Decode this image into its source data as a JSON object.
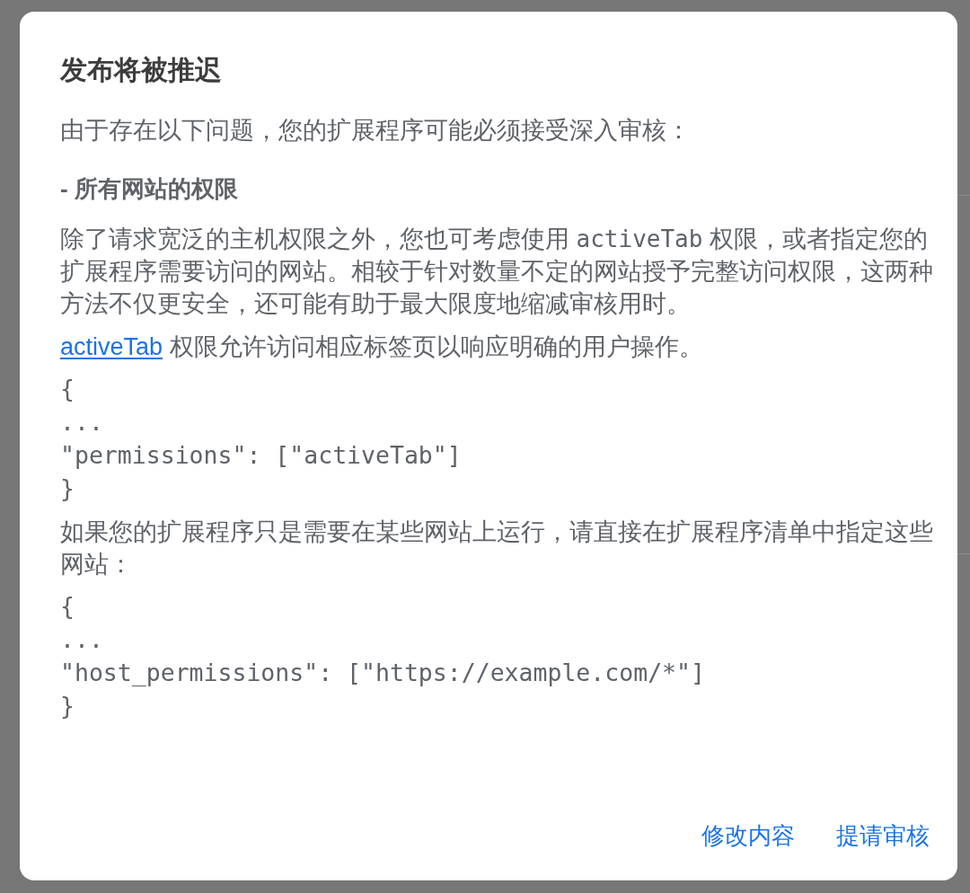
{
  "dialog": {
    "title": "发布将被推迟",
    "intro": "由于存在以下问题，您的扩展程序可能必须接受深入审核：",
    "issue_heading": "- 所有网站的权限",
    "blocks": [
      {
        "kind": "paragraph",
        "parts": [
          {
            "kind": "text",
            "text": "除了请求宽泛的主机权限之外，您也可考虑使用 "
          },
          {
            "kind": "code",
            "text": "activeTab"
          },
          {
            "kind": "text",
            "text": " 权限，或者指定您的扩展程序需要访问的网站。相较于针对数量不定的网站授予完整访问权限，这两种方法不仅更安全，还可能有助于最大限度地缩减审核用时。"
          }
        ]
      },
      {
        "kind": "paragraph",
        "parts": [
          {
            "kind": "link",
            "text": "activeTab"
          },
          {
            "kind": "text",
            "text": " 权限允许访问相应标签页以响应明确的用户操作。"
          }
        ]
      },
      {
        "kind": "code",
        "lines": [
          "{",
          "...",
          "\"permissions\": [\"activeTab\"]",
          "}"
        ]
      },
      {
        "kind": "paragraph",
        "parts": [
          {
            "kind": "text",
            "text": "如果您的扩展程序只是需要在某些网站上运行，请直接在扩展程序清单中指定这些网站："
          }
        ]
      },
      {
        "kind": "code",
        "lines": [
          "{",
          "...",
          "\"host_permissions\": [\"https://example.com/*\"]",
          "}"
        ]
      }
    ],
    "buttons": [
      {
        "label": "修改内容"
      },
      {
        "label": "提请审核"
      }
    ]
  }
}
